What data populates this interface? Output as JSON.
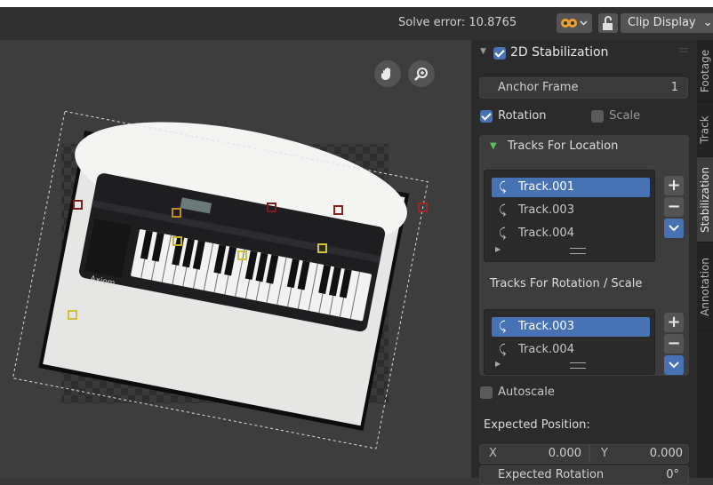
{
  "header": {
    "solve_error": "Solve error: 10.8765",
    "clip_display": "Clip Display"
  },
  "panel": {
    "title": "2D Stabilization",
    "anchor_frame_label": "Anchor Frame",
    "anchor_frame_value": "1",
    "rotation_label": "Rotation",
    "scale_label": "Scale",
    "tracks_location_label": "Tracks For Location",
    "location_tracks": [
      "Track.001",
      "Track.003",
      "Track.004"
    ],
    "tracks_rotation_label": "Tracks For Rotation / Scale",
    "rotation_tracks": [
      "Track.003",
      "Track.004"
    ],
    "autoscale_label": "Autoscale",
    "expected_position_label": "Expected Position:",
    "x_label": "X",
    "x_value": "0.000",
    "y_label": "Y",
    "y_value": "0.000",
    "expected_rotation_label": "Expected Rotation",
    "expected_rotation_value": "0°"
  },
  "tabs": [
    "Footage",
    "Track",
    "Stabilization",
    "Annotation"
  ],
  "clip": {
    "brand_label": "Axiom"
  },
  "colors": {
    "accent": "#4772b3",
    "panel_bg": "#2b2b2b",
    "viewport_bg": "#3d3d3d"
  },
  "icons": [
    "hand-icon",
    "zoom-icon",
    "overlay-icon",
    "lock-icon",
    "track-icon",
    "plus-icon",
    "minus-icon",
    "chevron-down-icon",
    "play-icon",
    "drag-handle-icon",
    "checkbox-icon",
    "triangle-down-icon"
  ]
}
